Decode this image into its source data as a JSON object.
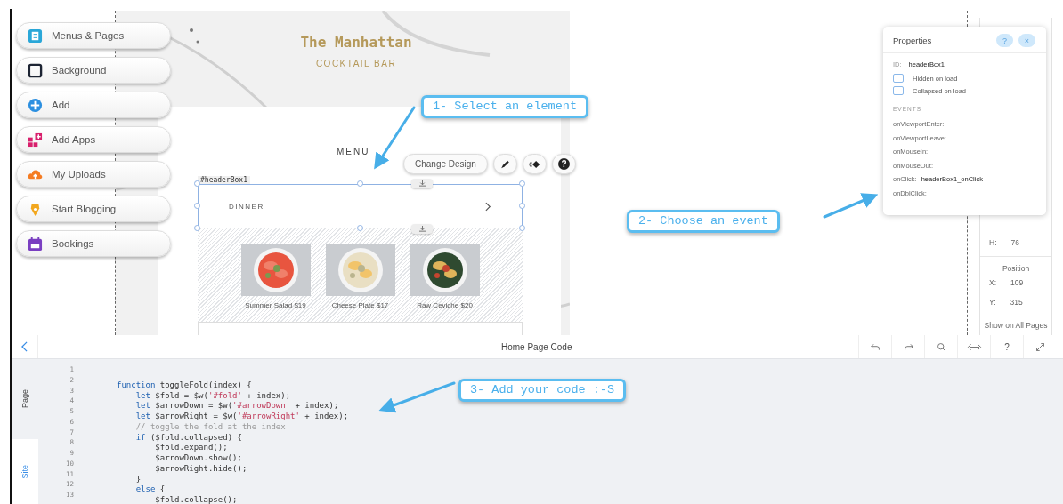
{
  "sidebar": {
    "items": [
      {
        "label": "Menus & Pages",
        "kind": "pages"
      },
      {
        "label": "Background",
        "kind": "background"
      },
      {
        "label": "Add",
        "kind": "add"
      },
      {
        "label": "Add Apps",
        "kind": "apps"
      },
      {
        "label": "My Uploads",
        "kind": "uploads"
      },
      {
        "label": "Start Blogging",
        "kind": "blog"
      },
      {
        "label": "Bookings",
        "kind": "bookings"
      }
    ]
  },
  "site": {
    "title": "The Manhattan",
    "subtitle": "COCKTAIL BAR",
    "section_title": "MENU",
    "element_id": "#headerBox1",
    "row_label": "DINNER",
    "dishes": [
      {
        "caption": "Summer Salad $19",
        "kind": "picture"
      },
      {
        "caption": "Cheese Plate $17",
        "kind": "picture"
      },
      {
        "caption": "Raw Ceviche $20",
        "kind": "picture"
      }
    ]
  },
  "element_toolbar": {
    "button": "Change Design",
    "help": "?"
  },
  "callouts": [
    {
      "text": "1- Select an element"
    },
    {
      "text": "2- Choose an event"
    },
    {
      "text": "3- Add your code :-S"
    }
  ],
  "properties": {
    "title": "Properties",
    "help": "?",
    "close": "×",
    "id_label": "ID:",
    "id_value": "headerBox1",
    "options": [
      {
        "label": "Hidden on load",
        "checked": false
      },
      {
        "label": "Collapsed on load",
        "checked": false
      }
    ],
    "events_heading": "EVENTS",
    "events": [
      {
        "name": "onViewportEnter:"
      },
      {
        "name": "onViewportLeave:"
      },
      {
        "name": "onMouseIn:"
      },
      {
        "name": "onMouseOut:"
      },
      {
        "name": "onClick:",
        "handler": "headerBox1_onClick"
      },
      {
        "name": "onDblClick:"
      }
    ]
  },
  "layout_panel": {
    "height_label": "H:",
    "height_value": "76",
    "position_heading": "Position",
    "x_label": "X:",
    "x_value": "109",
    "y_label": "Y:",
    "y_value": "315",
    "show_on_all_pages": "Show on All Pages"
  },
  "code_panel": {
    "title": "Home Page Code",
    "help": "?",
    "side_tabs": [
      {
        "label": "Page",
        "selected": false
      },
      {
        "label": "Site",
        "selected": true
      }
    ],
    "lines": [
      {
        "number": "1"
      },
      {
        "number": "2",
        "segments": [
          {
            "kind": "keyword",
            "text": "function"
          },
          {
            "kind": "plain",
            "text": " toggleFold(index) {"
          }
        ]
      },
      {
        "number": "3",
        "segments": [
          {
            "kind": "keyword",
            "text": "    let"
          },
          {
            "kind": "plain",
            "text": " $fold = $w("
          },
          {
            "kind": "string",
            "text": "'#fold'"
          },
          {
            "kind": "plain",
            "text": " + index);"
          }
        ]
      },
      {
        "number": "4",
        "segments": [
          {
            "kind": "keyword",
            "text": "    let"
          },
          {
            "kind": "plain",
            "text": " $arrowDown = $w("
          },
          {
            "kind": "string",
            "text": "'#arrowDown'"
          },
          {
            "kind": "plain",
            "text": " + index);"
          }
        ]
      },
      {
        "number": "5",
        "segments": [
          {
            "kind": "keyword",
            "text": "    let"
          },
          {
            "kind": "plain",
            "text": " $arrowRight = $w("
          },
          {
            "kind": "string",
            "text": "'#arrowRight'"
          },
          {
            "kind": "plain",
            "text": " + index);"
          }
        ]
      },
      {
        "number": "6",
        "segments": [
          {
            "kind": "comment",
            "text": "    // toggle the fold at the index"
          }
        ]
      },
      {
        "number": "7",
        "segments": [
          {
            "kind": "keyword",
            "text": "    if"
          },
          {
            "kind": "plain",
            "text": " ($fold.collapsed) {"
          }
        ]
      },
      {
        "number": "8",
        "segments": [
          {
            "kind": "plain",
            "text": "        $fold.expand();"
          }
        ]
      },
      {
        "number": "9",
        "segments": [
          {
            "kind": "plain",
            "text": "        $arrowDown.show();"
          }
        ]
      },
      {
        "number": "10",
        "segments": [
          {
            "kind": "plain",
            "text": "        $arrowRight.hide();"
          }
        ]
      },
      {
        "number": "11",
        "segments": [
          {
            "kind": "plain",
            "text": "    }"
          }
        ]
      },
      {
        "number": "12",
        "segments": [
          {
            "kind": "keyword",
            "text": "    else"
          },
          {
            "kind": "plain",
            "text": " {"
          }
        ]
      },
      {
        "number": "13",
        "segments": [
          {
            "kind": "plain",
            "text": "        $fold.collapse();"
          }
        ]
      }
    ]
  }
}
